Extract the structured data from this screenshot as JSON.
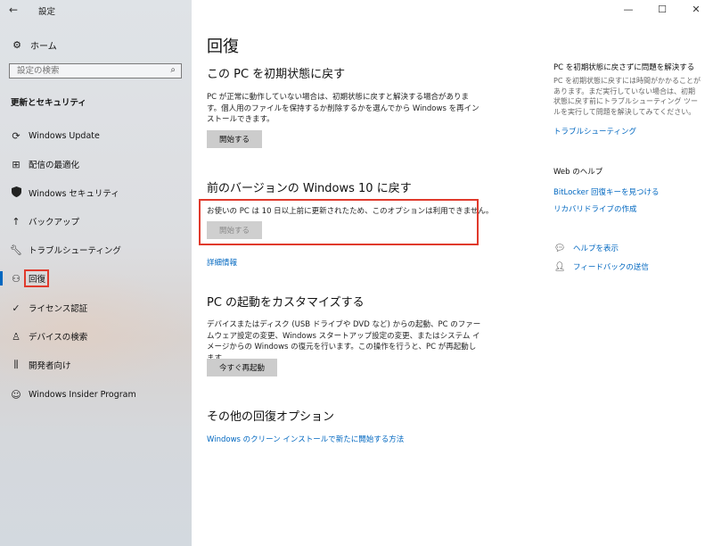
{
  "window": {
    "title": "設定",
    "controls": [
      "—",
      "☐",
      "✕"
    ]
  },
  "sidebar": {
    "back": "←",
    "home_label": "ホーム",
    "search_placeholder": "設定の検索",
    "section_title": "更新とセキュリティ",
    "items": [
      {
        "label": "Windows Update",
        "icon": "sync-icon"
      },
      {
        "label": "配信の最適化",
        "icon": "delivery-optimization-icon"
      },
      {
        "label": "Windows セキュリティ",
        "icon": "shield-icon"
      },
      {
        "label": "バックアップ",
        "icon": "backup-arrow-icon"
      },
      {
        "label": "トラブルシューティング",
        "icon": "wrench-icon"
      },
      {
        "label": "回復",
        "icon": "recovery-icon",
        "active": true
      },
      {
        "label": "ライセンス認証",
        "icon": "check-circle-icon"
      },
      {
        "label": "デバイスの検索",
        "icon": "person-location-icon"
      },
      {
        "label": "開発者向け",
        "icon": "developer-icon"
      },
      {
        "label": "Windows Insider Program",
        "icon": "insider-cat-icon"
      }
    ],
    "accent_color": "#0067c0",
    "highlight_color": "#e03a2c"
  },
  "main": {
    "title": "回復",
    "reset": {
      "heading": "この PC を初期状態に戻す",
      "description": "PC が正常に動作していない場合は、初期状態に戻すと解決する場合があります。個人用のファイルを保持するか削除するかを選んでから Windows を再インストールできます。",
      "button": "開始する"
    },
    "rollback": {
      "heading": "前のバージョンの Windows 10 に戻す",
      "description": "お使いの PC は 10 日以上前に更新されたため、このオプションは利用できません。",
      "button": "開始する",
      "link": "詳細情報"
    },
    "startup": {
      "heading": "PC の起動をカスタマイズする",
      "description": "デバイスまたはディスク (USB ドライブや DVD など) からの起動、PC のファームウェア設定の変更、Windows スタートアップ設定の変更、またはシステム イメージからの Windows の復元を行います。この操作を行うと、PC が再起動します。",
      "button": "今すぐ再起動"
    },
    "other": {
      "heading": "その他の回復オプション",
      "link": "Windows のクリーン インストールで新たに開始する方法"
    }
  },
  "right": {
    "tip_heading": "PC を初期状態に戻さずに問題を解決する",
    "tip_text": "PC を初期状態に戻すには時間がかかることがあります。まだ実行していない場合は、初期状態に戻す前にトラブルシューティング ツールを実行して問題を解決してみてください。",
    "tip_link": "トラブルシューティング",
    "web_heading": "Web のヘルプ",
    "web_links": [
      "BitLocker 回復キーを見つける",
      "リカバリドライブの作成"
    ],
    "help_link": "ヘルプを表示",
    "feedback_link": "フィードバックの送信"
  }
}
